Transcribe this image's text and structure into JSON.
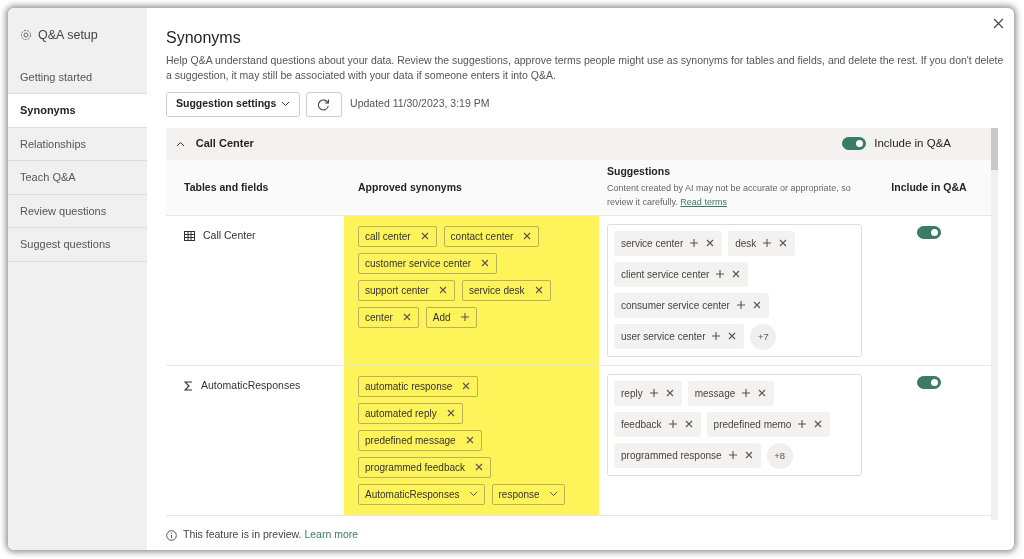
{
  "sidebar": {
    "title": "Q&A setup",
    "items": [
      {
        "label": "Getting started",
        "selected": false
      },
      {
        "label": "Synonyms",
        "selected": true
      },
      {
        "label": "Relationships",
        "selected": false
      },
      {
        "label": "Teach Q&A",
        "selected": false
      },
      {
        "label": "Review questions",
        "selected": false
      },
      {
        "label": "Suggest questions",
        "selected": false
      }
    ]
  },
  "header": {
    "title": "Synonyms",
    "description": "Help Q&A understand questions about your data. Review the suggestions, approve terms people might use as synonyms for tables and fields, and delete the rest. If you don't delete a suggestion, it may still be associated with your data if someone enters it into Q&A.",
    "settings_button": "Suggestion settings",
    "updated": "Updated 11/30/2023, 3:19 PM"
  },
  "section": {
    "title": "Call Center",
    "expanded": true,
    "include_label": "Include in Q&A",
    "include_on": true,
    "columns": {
      "fields": "Tables and fields",
      "approved": "Approved synonyms",
      "suggestions_title": "Suggestions",
      "suggestions_note": "Content created by AI may not be accurate or appropriate, so review it carefully.",
      "read_terms": "Read terms",
      "include": "Include in Q&A"
    },
    "rows": [
      {
        "name": "Call Center",
        "kind": "table",
        "approved": [
          {
            "label": "call center",
            "kind": "chip"
          },
          {
            "label": "contact center",
            "kind": "chip"
          },
          {
            "label": "customer service center",
            "kind": "chip"
          },
          {
            "label": "support center",
            "kind": "chip"
          },
          {
            "label": "service desk",
            "kind": "chip"
          },
          {
            "label": "center",
            "kind": "chip"
          }
        ],
        "add_label": "Add",
        "suggestions": [
          "service center",
          "desk",
          "client service center",
          "consumer service center",
          "user service center"
        ],
        "more": "+7",
        "include": true
      },
      {
        "name": "AutomaticResponses",
        "kind": "measure",
        "approved": [
          {
            "label": "automatic response",
            "kind": "chip"
          },
          {
            "label": "automated reply",
            "kind": "chip"
          },
          {
            "label": "predefined message",
            "kind": "chip"
          },
          {
            "label": "programmed feedback",
            "kind": "chip"
          },
          {
            "label": "AutomaticResponses",
            "kind": "select"
          },
          {
            "label": "response",
            "kind": "select"
          }
        ],
        "suggestions": [
          "reply",
          "message",
          "feedback",
          "predefined memo",
          "programmed response"
        ],
        "more": "+8",
        "include": true
      }
    ]
  },
  "footer": {
    "text": "This feature is in preview.",
    "link": "Learn more"
  }
}
